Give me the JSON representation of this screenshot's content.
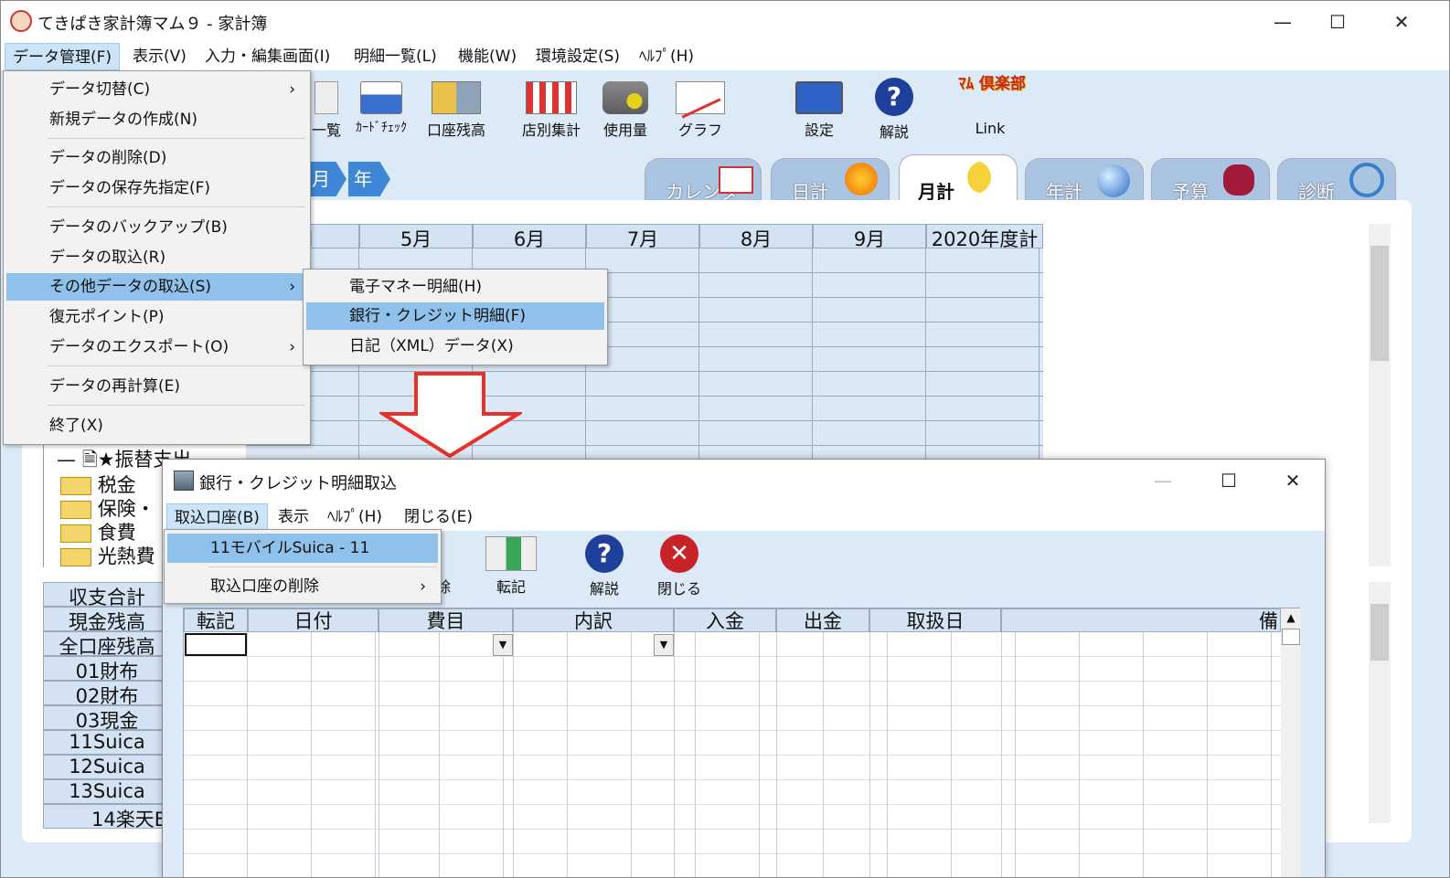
{
  "window": {
    "title": "てきぱき家計簿マム９ - 家計簿",
    "min": "—",
    "max": "☐",
    "close": "✕"
  },
  "menubar": [
    "データ管理(F)",
    "表示(V)",
    "入力・編集画面(I)",
    "明細一覧(L)",
    "機能(W)",
    "環境設定(S)",
    "ﾍﾙﾌﾟ(H)"
  ],
  "toolbar": [
    "一覧",
    "ｶｰﾄﾞﾁｪｯｸ",
    "口座残高",
    "店別集計",
    "使用量",
    "グラフ",
    "設定",
    "解説",
    "Link"
  ],
  "club_logo": "ﾏﾑ 倶楽部",
  "nav": {
    "month": "月",
    "year": "年"
  },
  "tabs": [
    "カレンダ",
    "日計",
    "月計",
    "年計",
    "予算",
    "診断"
  ],
  "month_table": {
    "first_col": "月",
    "headers": [
      "5月",
      "6月",
      "7月",
      "8月",
      "9月",
      "2020年度計"
    ]
  },
  "tree": [
    "★振替支出",
    "税金",
    "保険・",
    "食費",
    "光熱費"
  ],
  "summary_rows": [
    "収支合計",
    "現金残高",
    "全口座残高",
    "01財布",
    "02財布",
    "03現金",
    "11Suica",
    "12Suica",
    "13Suica",
    "14楽天E"
  ],
  "file_menu": {
    "items": [
      "データ切替(C)",
      "新規データの作成(N)",
      "データの削除(D)",
      "データの保存先指定(F)",
      "データのバックアップ(B)",
      "データの取込(R)",
      "その他データの取込(S)",
      "復元ポイント(P)",
      "データのエクスポート(O)",
      "データの再計算(E)",
      "終了(X)"
    ],
    "arrow": "›"
  },
  "submenu": [
    "電子マネー明細(H)",
    "銀行・クレジット明細(F)",
    "日記（XML）データ(X)"
  ],
  "dialog": {
    "title": "銀行・クレジット明細取込",
    "menubar": [
      "取込口座(B)",
      "表示",
      "ﾍﾙﾌﾟ(H)",
      "閉じる(E)"
    ],
    "account_menu": [
      "11モバイルSuica - 11",
      "取込口座の削除"
    ],
    "toolbar": [
      "除",
      "転記",
      "解説",
      "閉じる"
    ],
    "grid_headers": [
      "転記",
      "日付",
      "費目",
      "内訳",
      "入金",
      "出金",
      "取扱日",
      "備"
    ],
    "dropdown_arrow": "▼"
  },
  "colors": {
    "menu_highlight": "#8fc1ea",
    "workarea": "#dce9f6",
    "header_cell": "#d4e3f4",
    "arrow": "#e8312a"
  }
}
